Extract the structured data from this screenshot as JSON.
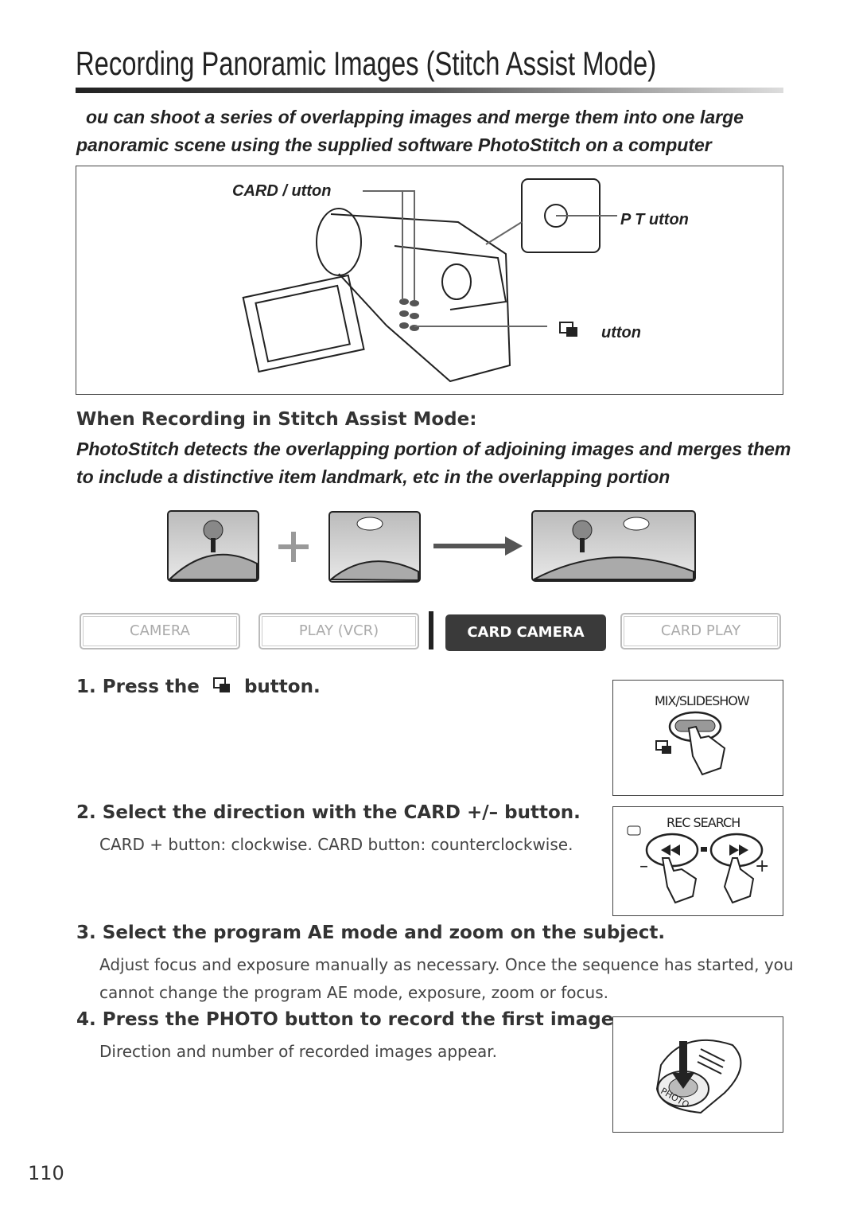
{
  "title": "Recording Panoramic Images (Stitch Assist Mode)",
  "intro": [
    "ou can shoot a series of overlapping images and merge them into one large",
    "panoramic scene using the supplied software  PhotoStitch  on a computer"
  ],
  "diagram": {
    "card_button": "CARD   /   utton",
    "photo_button": "P     T       utton",
    "stitch_button": "utton"
  },
  "subheading": "When Recording in Stitch Assist Mode:",
  "note": [
    "PhotoStitch detects the overlapping portion of adjoining images and merges them",
    "to include a distinctive item  landmark, etc   in the overlapping portion"
  ],
  "modes": [
    {
      "label": "CAMERA",
      "active": false
    },
    {
      "label": "PLAY (VCR)",
      "active": false
    },
    {
      "label": "CARD CAMERA",
      "active": true
    },
    {
      "label": "CARD PLAY",
      "active": false
    }
  ],
  "steps": [
    {
      "title_pre": "1. Press the",
      "title_post": "button.",
      "body": []
    },
    {
      "title": "2. Select the direction with the CARD +/– button.",
      "body": [
        "CARD + button: clockwise. CARD  button: counterclockwise."
      ]
    },
    {
      "title": "3. Select the program AE mode and zoom on the subject.",
      "body": [
        "Adjust focus and exposure manually as necessary. Once the sequence has started, you",
        "cannot change the program AE mode, exposure, zoom or focus."
      ]
    },
    {
      "title": "4. Press the PHOTO button to record the first image.",
      "body": [
        "Direction and number of recorded images appear."
      ]
    }
  ],
  "figures": {
    "mix": "MIX/SLIDESHOW",
    "rec": "REC SEARCH",
    "minus": "–",
    "plus": "+",
    "photo": "PHOTO"
  },
  "page_number": "110"
}
